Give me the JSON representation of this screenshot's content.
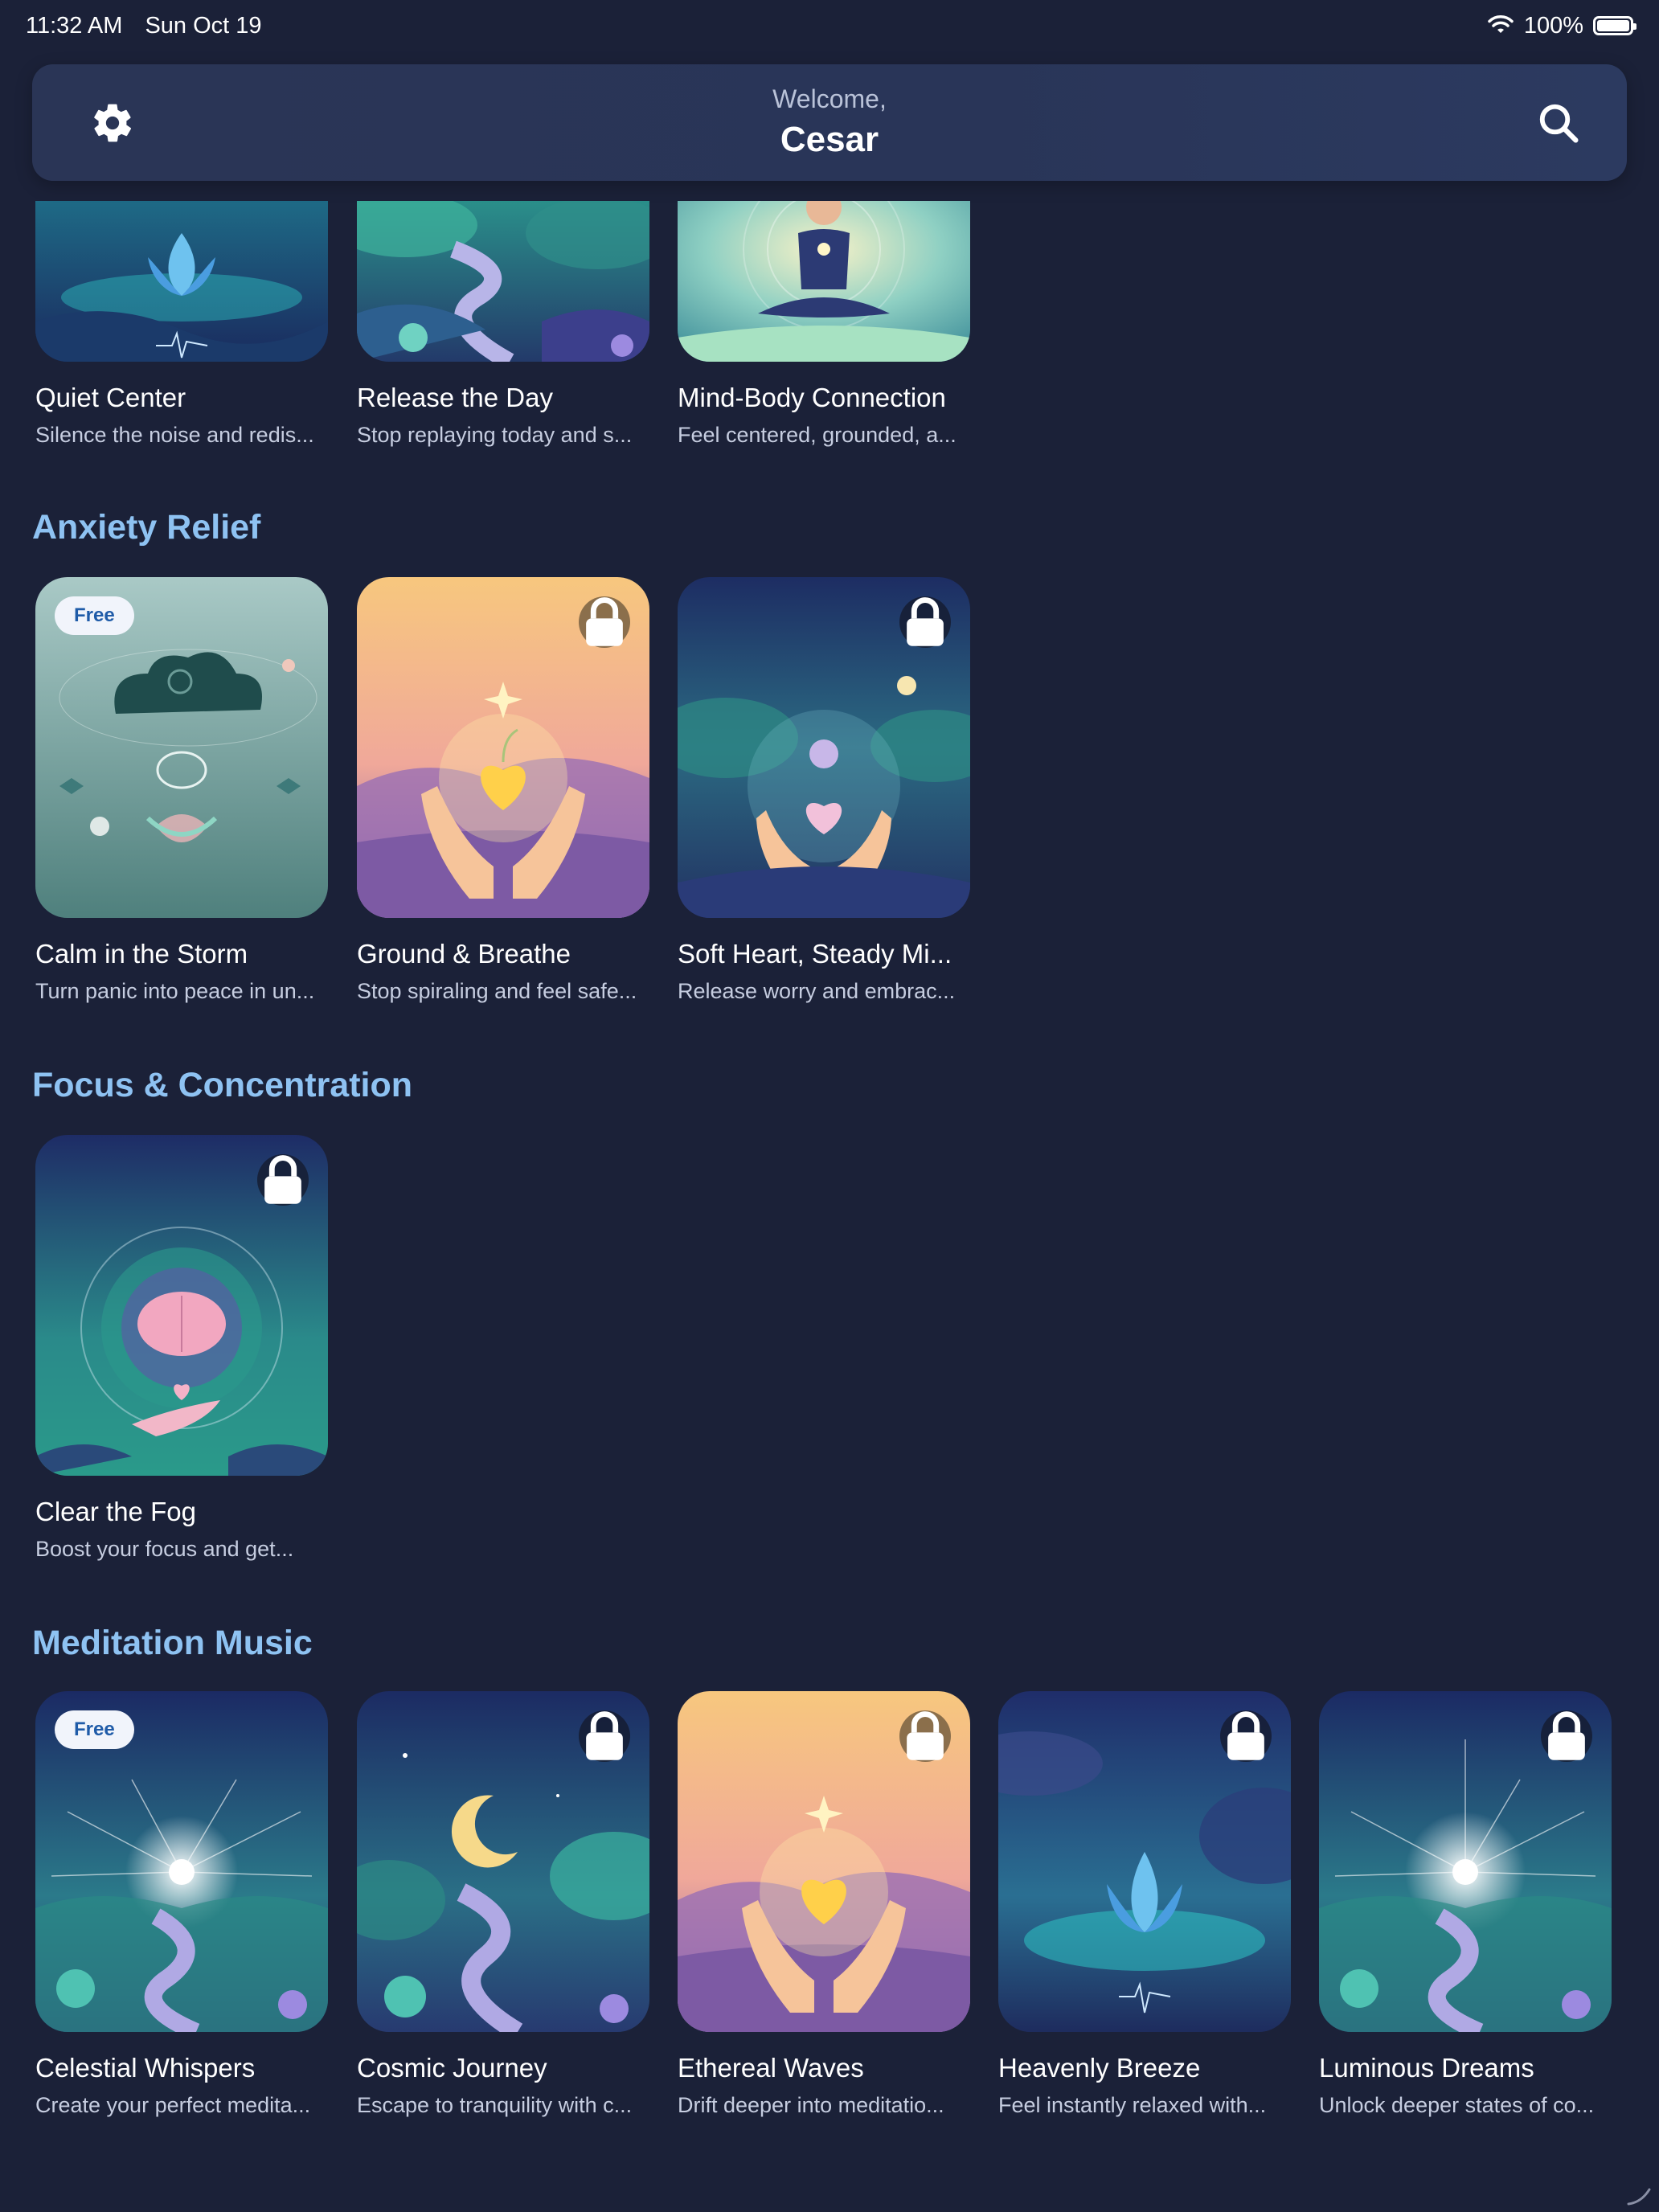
{
  "status_bar": {
    "time": "11:32 AM",
    "date": "Sun Oct 19",
    "battery": "100%",
    "battery_level": 1.0
  },
  "header": {
    "greeting": "Welcome,",
    "user_name": "Cesar"
  },
  "top_row": [
    {
      "title": "Quiet Center",
      "subtitle": "Silence the noise and redis..."
    },
    {
      "title": "Release the Day",
      "subtitle": "Stop replaying today and s..."
    },
    {
      "title": "Mind-Body Connection",
      "subtitle": "Feel centered, grounded, a..."
    }
  ],
  "sections": [
    {
      "title": "Anxiety Relief",
      "items": [
        {
          "title": "Calm in the Storm",
          "subtitle": "Turn panic into peace in un...",
          "badge": "Free"
        },
        {
          "title": "Ground & Breathe",
          "subtitle": "Stop spiraling and feel safe...",
          "badge": "lock"
        },
        {
          "title": "Soft Heart, Steady Mi...",
          "subtitle": "Release worry and embrac...",
          "badge": "lock"
        }
      ]
    },
    {
      "title": "Focus & Concentration",
      "items": [
        {
          "title": "Clear the Fog",
          "subtitle": "Boost your focus and get...",
          "badge": "lock"
        }
      ]
    },
    {
      "title": "Meditation Music",
      "items": [
        {
          "title": "Celestial Whispers",
          "subtitle": "Create your perfect medita...",
          "badge": "Free"
        },
        {
          "title": "Cosmic Journey",
          "subtitle": "Escape to tranquility with c...",
          "badge": "lock"
        },
        {
          "title": "Ethereal Waves",
          "subtitle": "Drift deeper into meditatio...",
          "badge": "lock"
        },
        {
          "title": "Heavenly Breeze",
          "subtitle": "Feel instantly relaxed with...",
          "badge": "lock"
        },
        {
          "title": "Luminous Dreams",
          "subtitle": "Unlock deeper states of co...",
          "badge": "lock"
        }
      ]
    }
  ],
  "icons": {
    "settings": "gear-icon",
    "search": "search-icon",
    "lock": "lock-icon",
    "wifi": "wifi-icon",
    "battery": "battery-icon"
  },
  "colors": {
    "background": "#1b2138",
    "header": "#2a3556",
    "section_title": "#8ec2f2",
    "badge_free_bg": "#f1f4fb",
    "badge_free_text": "#1f5ba8"
  }
}
